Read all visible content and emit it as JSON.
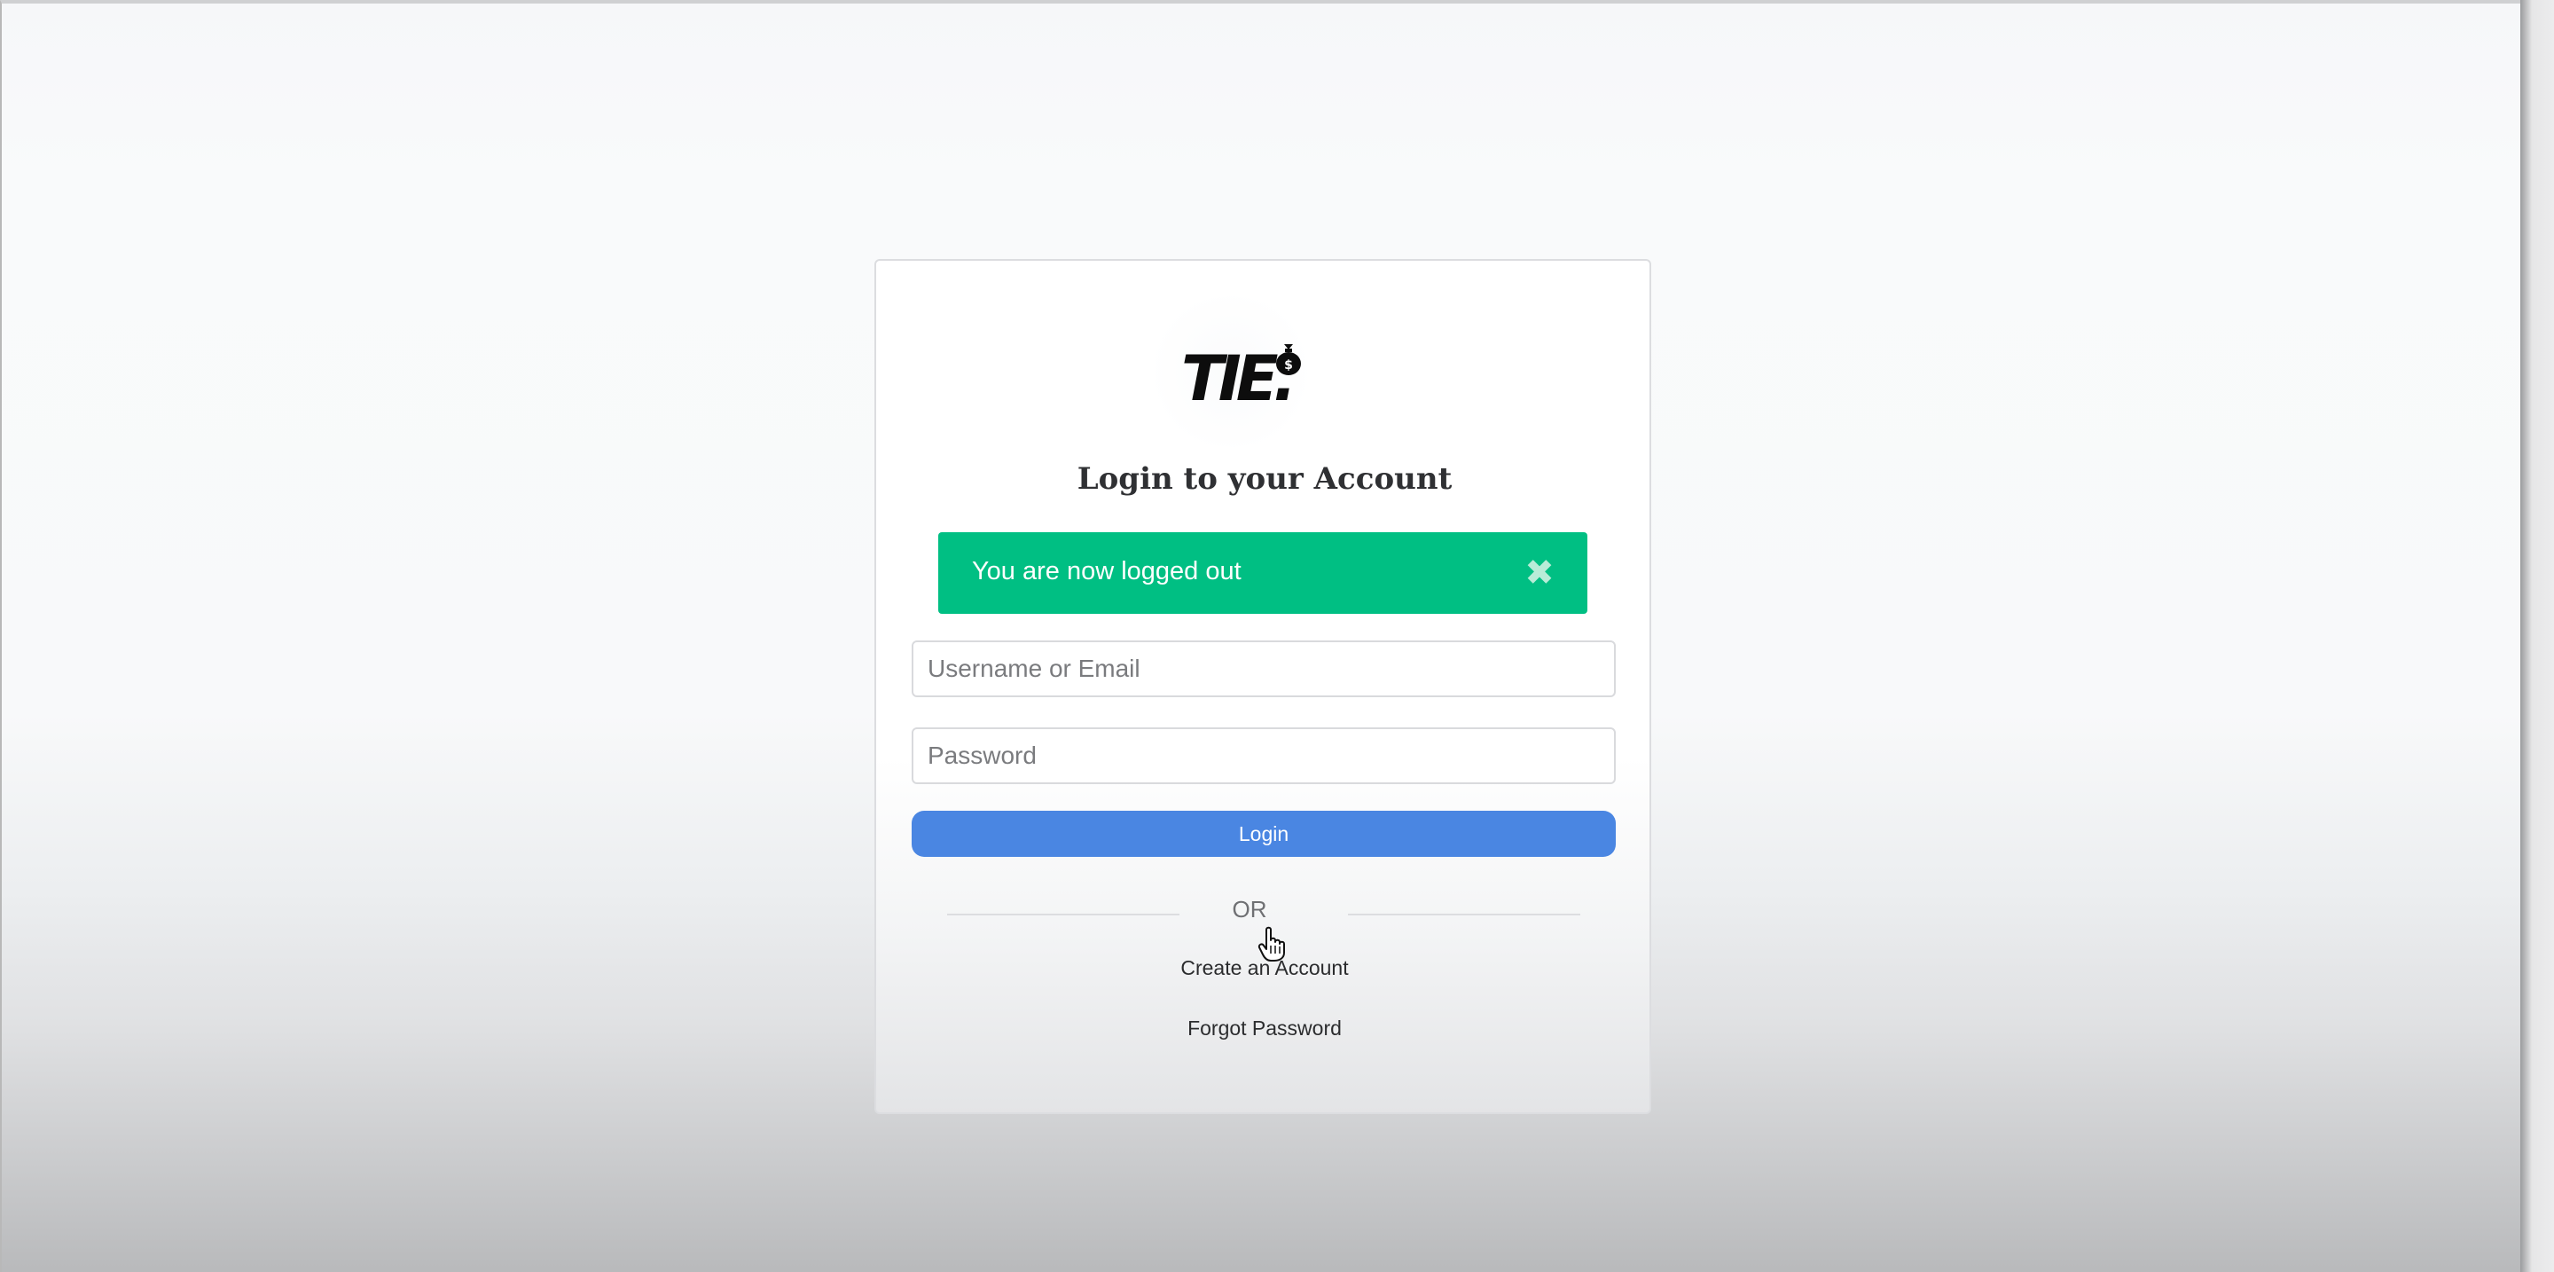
{
  "brand": {
    "logo_text": "TIE."
  },
  "login": {
    "title": "Login to your Account",
    "alert_message": "You are now logged out",
    "alert_close_icon": "close-x-icon",
    "username_placeholder": "Username or Email",
    "username_value": "",
    "password_placeholder": "Password",
    "password_value": "",
    "login_button": "Login",
    "divider_text": "OR",
    "create_account_link": "Create an Account",
    "forgot_password_link": "Forgot Password"
  },
  "colors": {
    "alert_green": "#00bf83",
    "primary_blue": "#4a86e2",
    "title_text": "#2f3033"
  }
}
